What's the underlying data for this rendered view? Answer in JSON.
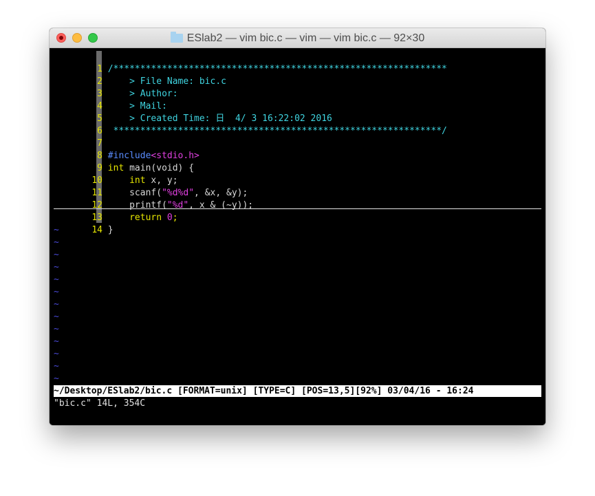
{
  "window": {
    "title": "ESlab2 — vim bic.c — vim — vim bic.c — 92×30",
    "title_icon": "folder-icon"
  },
  "editor": {
    "lines": [
      {
        "num": "1",
        "text": "/**************************************************************"
      },
      {
        "num": "2",
        "text": "    > File Name: bic.c"
      },
      {
        "num": "3",
        "text": "    > Author:"
      },
      {
        "num": "4",
        "text": "    > Mail:"
      },
      {
        "num": "5",
        "text": "    > Created Time: 日  4/ 3 16:22:02 2016"
      },
      {
        "num": "6",
        "text": " *************************************************************/"
      },
      {
        "num": "7",
        "text": ""
      },
      {
        "num": "8",
        "directive": "#include",
        "include_file": "<stdio.h>"
      },
      {
        "num": "9",
        "type_kw": "int",
        "rest": " main(void) {"
      },
      {
        "num": "10",
        "indent": "    ",
        "type_kw": "int",
        "rest": " x, y;"
      },
      {
        "num": "11",
        "indent": "    ",
        "pre": "scanf(",
        "str": "\"%d%d\"",
        "post": ", &x, &y);"
      },
      {
        "num": "12",
        "indent": "    ",
        "pre": "printf(",
        "str": "\"%d\"",
        "post": ", x & (~y));"
      },
      {
        "num": "13",
        "indent": "    ",
        "kw": "return",
        "sp": " ",
        "numval": "0",
        "post": ";"
      },
      {
        "num": "14",
        "text": "}"
      }
    ],
    "tilde": "~"
  },
  "statusline": {
    "text": "~/Desktop/ESlab2/bic.c [FORMAT=unix] [TYPE=C] [POS=13,5][92%] 03/04/16 - 16:24"
  },
  "message": {
    "text": "\"bic.c\" 14L, 354C"
  },
  "colors": {
    "line_number": "#e6e600",
    "comment": "#3fd4e0",
    "keyword": "#e6e600",
    "string": "#e040e0",
    "tilde": "#4a4ad8",
    "background": "#000000"
  }
}
